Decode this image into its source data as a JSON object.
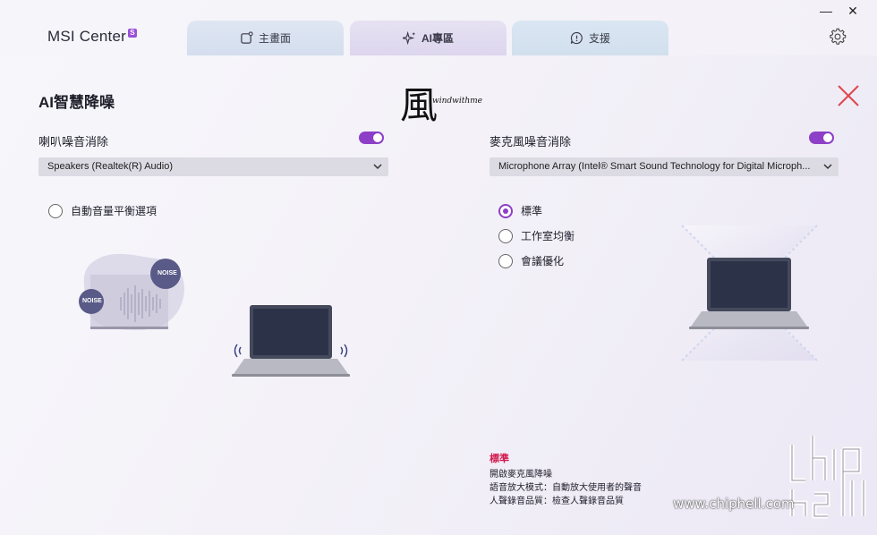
{
  "app": {
    "name": "MSI Center",
    "badge": "S"
  },
  "tabs": [
    {
      "label": "主畫面",
      "icon": "home-icon"
    },
    {
      "label": "AI專區",
      "icon": "sparkle-icon"
    },
    {
      "label": "支援",
      "icon": "help-icon"
    }
  ],
  "window": {
    "minimize": "—",
    "close": "✕"
  },
  "page": {
    "title": "AI智慧降噪",
    "watermark_char": "風",
    "watermark_text": "windwithme"
  },
  "speaker": {
    "label": "喇叭噪音消除",
    "enabled": true,
    "device": "Speakers (Realtek(R) Audio)",
    "option_label": "自動音量平衡選項",
    "noise_badge": "NOISE"
  },
  "mic": {
    "label": "麥克風噪音消除",
    "enabled": true,
    "device": "Microphone Array (Intel® Smart Sound Technology for Digital Microph...",
    "options": [
      "標準",
      "工作室均衡",
      "會議優化"
    ],
    "selected": "標準"
  },
  "info": {
    "heading": "標準",
    "lines": [
      "開啟麥克風降噪",
      "語音放大模式：自動放大使用者的聲音",
      "人聲錄音品質：檢查人聲錄音品質"
    ]
  },
  "watermark_site": "www.chiphell.com",
  "colors": {
    "accent": "#8d3fc7",
    "highlight": "#d2184d",
    "close": "#e0464e"
  }
}
